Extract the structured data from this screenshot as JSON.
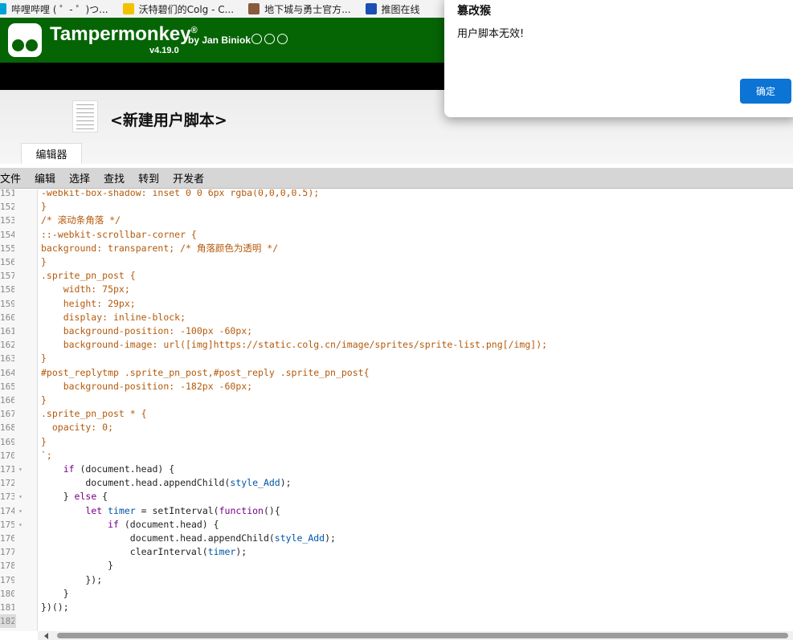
{
  "bookmarks": [
    {
      "label": "哔哩哔哩 ( ゜- ゜)つ...",
      "color": "#00a1d6"
    },
    {
      "label": "沃特碧们的Colg - C...",
      "color": "#f2c200"
    },
    {
      "label": "地下城与勇士官方...",
      "color": "#8a5a3c"
    },
    {
      "label": "推图在线",
      "color": "#1a4fb5"
    }
  ],
  "header": {
    "title": "Tampermonkey",
    "registered": "®",
    "by": "by Jan Biniok",
    "version": "v4.19.0",
    "social_icons": [
      "github-icon",
      "facebook-icon",
      "instagram-icon"
    ],
    "brand_color": "#056505"
  },
  "script": {
    "name": "<新建用户脚本>",
    "tab_label": "编辑器"
  },
  "menu": [
    "文件",
    "编辑",
    "选择",
    "查找",
    "转到",
    "开发者"
  ],
  "editor": {
    "lines": [
      {
        "n": "151",
        "fold": false,
        "active": false,
        "tokens": [
          {
            "t": "-webkit-box-shadow: inset 0 0 6px rgba(0,0,0,0.5);",
            "c": "c-css"
          }
        ]
      },
      {
        "n": "152",
        "fold": false,
        "active": false,
        "tokens": [
          {
            "t": "}",
            "c": "c-css"
          }
        ]
      },
      {
        "n": "153",
        "fold": false,
        "active": false,
        "tokens": [
          {
            "t": "/* 滚动条角落 */",
            "c": "c-css"
          }
        ]
      },
      {
        "n": "154",
        "fold": false,
        "active": false,
        "tokens": [
          {
            "t": "::-webkit-scrollbar-corner {",
            "c": "c-css"
          }
        ]
      },
      {
        "n": "155",
        "fold": false,
        "active": false,
        "tokens": [
          {
            "t": "background: transparent; /* 角落颜色为透明 */",
            "c": "c-css"
          }
        ]
      },
      {
        "n": "156",
        "fold": false,
        "active": false,
        "tokens": [
          {
            "t": "}",
            "c": "c-css"
          }
        ]
      },
      {
        "n": "157",
        "fold": false,
        "active": false,
        "tokens": [
          {
            "t": ".sprite_pn_post {",
            "c": "c-css"
          }
        ]
      },
      {
        "n": "158",
        "fold": false,
        "active": false,
        "tokens": [
          {
            "t": "    width: 75px;",
            "c": "c-css"
          }
        ]
      },
      {
        "n": "159",
        "fold": false,
        "active": false,
        "tokens": [
          {
            "t": "    height: 29px;",
            "c": "c-css"
          }
        ]
      },
      {
        "n": "160",
        "fold": false,
        "active": false,
        "tokens": [
          {
            "t": "    display: inline-block;",
            "c": "c-css"
          }
        ]
      },
      {
        "n": "161",
        "fold": false,
        "active": false,
        "tokens": [
          {
            "t": "    background-position: -100px -60px;",
            "c": "c-css"
          }
        ]
      },
      {
        "n": "162",
        "fold": false,
        "active": false,
        "tokens": [
          {
            "t": "    background-image: url([img]https://static.colg.cn/image/sprites/sprite-list.png[/img]);",
            "c": "c-css"
          }
        ]
      },
      {
        "n": "163",
        "fold": false,
        "active": false,
        "tokens": [
          {
            "t": "}",
            "c": "c-css"
          }
        ]
      },
      {
        "n": "164",
        "fold": false,
        "active": false,
        "tokens": [
          {
            "t": "#post_replytmp .sprite_pn_post,#post_reply .sprite_pn_post{",
            "c": "c-css"
          }
        ]
      },
      {
        "n": "165",
        "fold": false,
        "active": false,
        "tokens": [
          {
            "t": "    background-position: -182px -60px;",
            "c": "c-css"
          }
        ]
      },
      {
        "n": "166",
        "fold": false,
        "active": false,
        "tokens": [
          {
            "t": "}",
            "c": "c-css"
          }
        ]
      },
      {
        "n": "167",
        "fold": false,
        "active": false,
        "tokens": [
          {
            "t": ".sprite_pn_post * {",
            "c": "c-css"
          }
        ]
      },
      {
        "n": "168",
        "fold": false,
        "active": false,
        "tokens": [
          {
            "t": "  opacity: 0;",
            "c": "c-css"
          }
        ]
      },
      {
        "n": "169",
        "fold": false,
        "active": false,
        "tokens": [
          {
            "t": "}",
            "c": "c-css"
          }
        ]
      },
      {
        "n": "170",
        "fold": false,
        "active": false,
        "tokens": [
          {
            "t": "`;",
            "c": "c-css"
          }
        ]
      },
      {
        "n": "171",
        "fold": true,
        "active": false,
        "tokens": [
          {
            "t": "    ",
            "c": "c-def"
          },
          {
            "t": "if",
            "c": "c-kw"
          },
          {
            "t": " (document.head) {",
            "c": "c-def"
          }
        ]
      },
      {
        "n": "172",
        "fold": false,
        "active": false,
        "tokens": [
          {
            "t": "        document.head.appendChild(",
            "c": "c-def"
          },
          {
            "t": "style_Add",
            "c": "c-var"
          },
          {
            "t": ");",
            "c": "c-def"
          }
        ]
      },
      {
        "n": "173",
        "fold": true,
        "active": false,
        "tokens": [
          {
            "t": "    } ",
            "c": "c-def"
          },
          {
            "t": "else",
            "c": "c-kw"
          },
          {
            "t": " {",
            "c": "c-def"
          }
        ]
      },
      {
        "n": "174",
        "fold": true,
        "active": false,
        "tokens": [
          {
            "t": "        ",
            "c": "c-def"
          },
          {
            "t": "let",
            "c": "c-kw"
          },
          {
            "t": " ",
            "c": "c-def"
          },
          {
            "t": "timer",
            "c": "c-var"
          },
          {
            "t": " = setInterval(",
            "c": "c-def"
          },
          {
            "t": "function",
            "c": "c-kw"
          },
          {
            "t": "(){",
            "c": "c-def"
          }
        ]
      },
      {
        "n": "175",
        "fold": true,
        "active": false,
        "tokens": [
          {
            "t": "            ",
            "c": "c-def"
          },
          {
            "t": "if",
            "c": "c-kw"
          },
          {
            "t": " (document.head) {",
            "c": "c-def"
          }
        ]
      },
      {
        "n": "176",
        "fold": false,
        "active": false,
        "tokens": [
          {
            "t": "                document.head.appendChild(",
            "c": "c-def"
          },
          {
            "t": "style_Add",
            "c": "c-var"
          },
          {
            "t": ");",
            "c": "c-def"
          }
        ]
      },
      {
        "n": "177",
        "fold": false,
        "active": false,
        "tokens": [
          {
            "t": "                clearInterval(",
            "c": "c-def"
          },
          {
            "t": "timer",
            "c": "c-var"
          },
          {
            "t": ");",
            "c": "c-def"
          }
        ]
      },
      {
        "n": "178",
        "fold": false,
        "active": false,
        "tokens": [
          {
            "t": "            }",
            "c": "c-def"
          }
        ]
      },
      {
        "n": "179",
        "fold": false,
        "active": false,
        "tokens": [
          {
            "t": "        });",
            "c": "c-def"
          }
        ]
      },
      {
        "n": "180",
        "fold": false,
        "active": false,
        "tokens": [
          {
            "t": "    }",
            "c": "c-def"
          }
        ]
      },
      {
        "n": "181",
        "fold": false,
        "active": false,
        "tokens": [
          {
            "t": "})();",
            "c": "c-def"
          }
        ]
      },
      {
        "n": "182",
        "fold": false,
        "active": true,
        "tokens": [
          {
            "t": "",
            "c": "c-def"
          }
        ]
      }
    ]
  },
  "dialog": {
    "title": "篡改猴",
    "message": "用户脚本无效!",
    "ok_label": "确定",
    "button_color": "#0b74d4"
  }
}
